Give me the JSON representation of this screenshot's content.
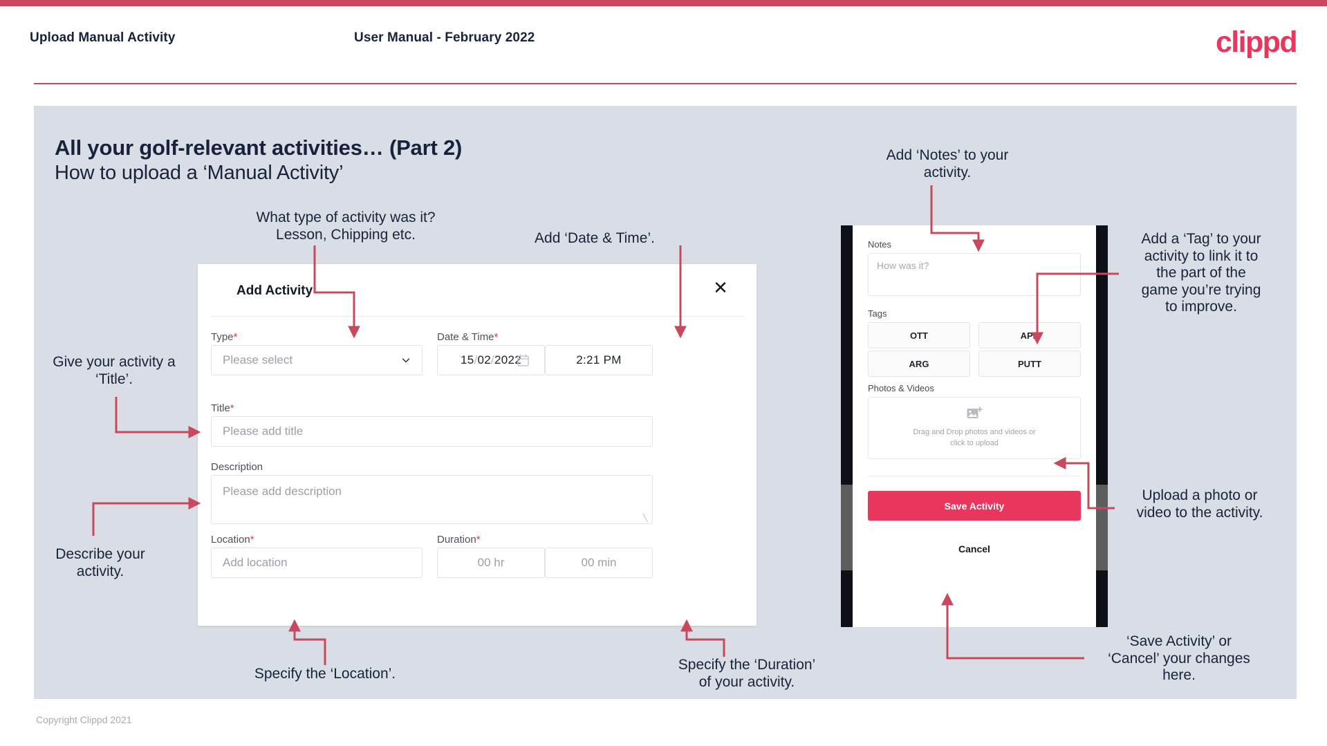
{
  "header": {
    "left_title": "Upload Manual Activity",
    "center_title": "User Manual - February 2022",
    "logo": "clippd"
  },
  "slide": {
    "title": "All your golf-relevant activities… (Part 2)",
    "subtitle": "How to upload a ‘Manual Activity’"
  },
  "annotations": {
    "type": "What type of activity was it?\nLesson, Chipping etc.",
    "datetime": "Add ‘Date & Time’.",
    "title": "Give your activity a\n‘Title’.",
    "description": "Describe your\nactivity.",
    "location": "Specify the ‘Location’.",
    "duration": "Specify the ‘Duration’\nof your activity.",
    "notes": "Add ‘Notes’ to your\nactivity.",
    "tags": "Add a ‘Tag’ to your\nactivity to link it to\nthe part of the\ngame you’re trying\nto improve.",
    "photos": "Upload a photo or\nvideo to the activity.",
    "save": "‘Save Activity’ or\n‘Cancel’ your changes\nhere."
  },
  "dialog": {
    "title": "Add Activity",
    "close_icon": "close-icon",
    "fields": {
      "type": {
        "label": "Type",
        "required": "*",
        "placeholder": "Please select",
        "chevron_icon": "chevron-down-icon"
      },
      "datetime": {
        "label": "Date & Time",
        "required": "*",
        "day": "15",
        "month": "02",
        "year": "2022",
        "separator": "/",
        "calendar_icon": "calendar-icon",
        "time": "2:21 PM"
      },
      "title": {
        "label": "Title",
        "required": "*",
        "placeholder": "Please add title"
      },
      "description": {
        "label": "Description",
        "required": "",
        "placeholder": "Please add description"
      },
      "location": {
        "label": "Location",
        "required": "*",
        "placeholder": "Add location"
      },
      "duration": {
        "label": "Duration",
        "required": "*",
        "hours_placeholder": "00 hr",
        "minutes_placeholder": "00 min"
      }
    }
  },
  "phone": {
    "notes": {
      "label": "Notes",
      "placeholder": "How was it?"
    },
    "tags": {
      "label": "Tags",
      "items": [
        "OTT",
        "APP",
        "ARG",
        "PUTT"
      ]
    },
    "photos": {
      "label": "Photos & Videos",
      "icon": "add-image-icon",
      "dropzone_text": "Drag and Drop photos and videos or\nclick to upload"
    },
    "save_label": "Save Activity",
    "cancel_label": "Cancel"
  },
  "footer": {
    "copyright": "Copyright Clippd 2021"
  },
  "colors": {
    "brand_pink": "#e8365d",
    "top_bar": "#c8485e",
    "slide_bg": "#d9dee6",
    "text_dark": "#17233b",
    "arrow": "#c8485e",
    "required_star": "#f0392f"
  }
}
